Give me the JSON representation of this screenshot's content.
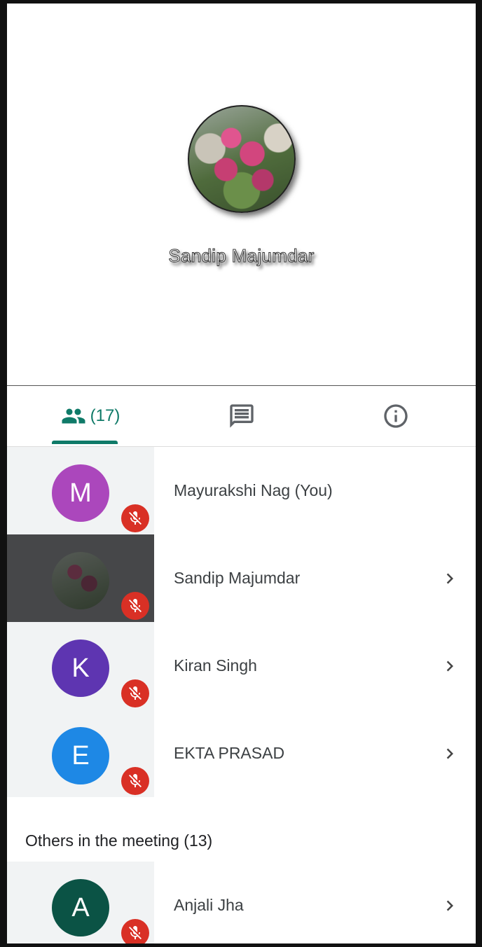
{
  "stage": {
    "speaker_name": "Sandip Majumdar"
  },
  "tabs": {
    "people_count": "(17)",
    "active_tab": "people",
    "accent_color": "#0f7a68"
  },
  "participants": [
    {
      "initial": "M",
      "name": "Mayurakshi Nag (You)",
      "avatar_color": "#ab47bc",
      "muted": true,
      "highlighted": false,
      "has_chevron": false
    },
    {
      "initial": "",
      "name": "Sandip Majumdar",
      "avatar_color": "photo",
      "muted": true,
      "highlighted": true,
      "has_chevron": true
    },
    {
      "initial": "K",
      "name": "Kiran Singh",
      "avatar_color": "#5e35b1",
      "muted": true,
      "highlighted": false,
      "has_chevron": true
    },
    {
      "initial": "E",
      "name": "EKTA PRASAD",
      "avatar_color": "#1e88e5",
      "muted": true,
      "highlighted": false,
      "has_chevron": true
    }
  ],
  "others_section": {
    "title": "Others in the meeting (13)",
    "participants": [
      {
        "initial": "A",
        "name": "Anjali Jha",
        "avatar_color": "#0b5345",
        "muted": true,
        "highlighted": false,
        "has_chevron": true
      }
    ]
  },
  "colors": {
    "mute_badge": "#d93025",
    "row_left_bg": "#f1f3f4",
    "highlight_bg": "#464749"
  }
}
